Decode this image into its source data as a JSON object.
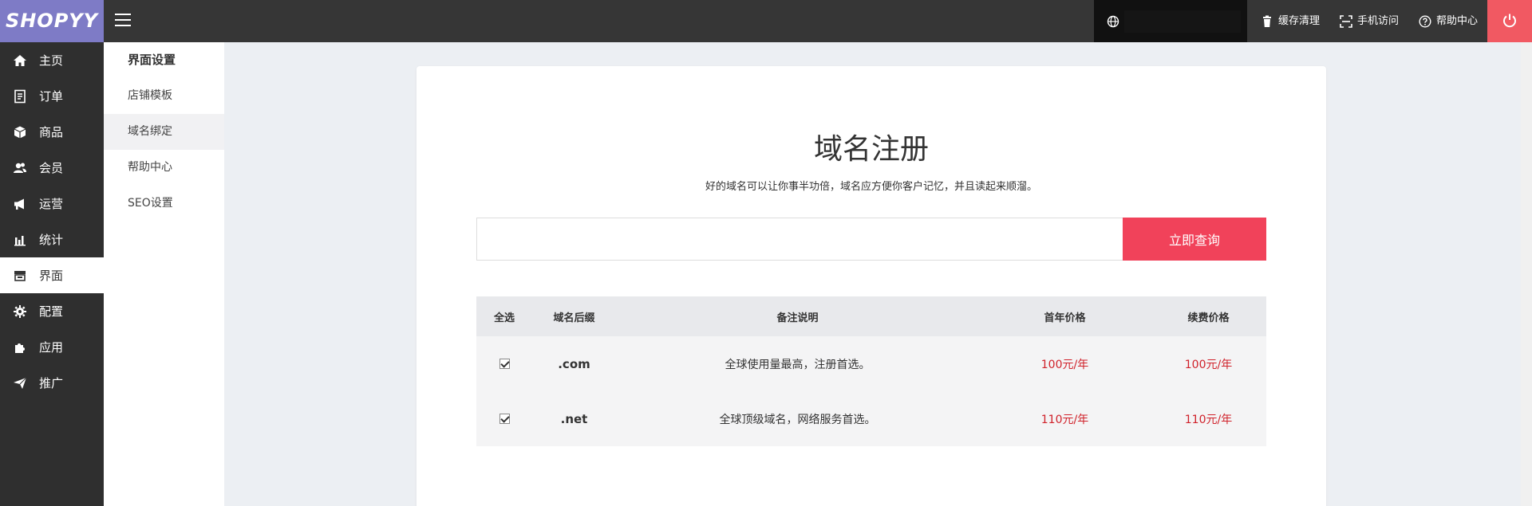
{
  "header": {
    "logo": "SHOPYY",
    "links": [
      {
        "label": "缓存清理",
        "icon": "trash-icon"
      },
      {
        "label": "手机访问",
        "icon": "mobile-scan-icon"
      },
      {
        "label": "帮助中心",
        "icon": "help-icon"
      }
    ],
    "power_icon": "power-icon"
  },
  "sidebar": {
    "items": [
      {
        "label": "主页",
        "icon": "home-icon"
      },
      {
        "label": "订单",
        "icon": "order-icon"
      },
      {
        "label": "商品",
        "icon": "box-icon"
      },
      {
        "label": "会员",
        "icon": "users-icon"
      },
      {
        "label": "运营",
        "icon": "megaphone-icon"
      },
      {
        "label": "统计",
        "icon": "bar-chart-icon"
      },
      {
        "label": "界面",
        "icon": "store-icon",
        "active": true
      },
      {
        "label": "配置",
        "icon": "gear-icon"
      },
      {
        "label": "应用",
        "icon": "puzzle-icon"
      },
      {
        "label": "推广",
        "icon": "paper-plane-icon"
      }
    ]
  },
  "subnav": {
    "title": "界面设置",
    "items": [
      {
        "label": "店铺模板"
      },
      {
        "label": "域名绑定",
        "active": true
      },
      {
        "label": "帮助中心"
      },
      {
        "label": "SEO设置"
      }
    ]
  },
  "main": {
    "title": "域名注册",
    "subtitle": "好的域名可以让你事半功倍，域名应方便你客户记忆，并且读起来顺溜。",
    "search": {
      "value": "",
      "placeholder": "",
      "button_label": "立即查询"
    },
    "table": {
      "headers": [
        "全选",
        "域名后缀",
        "备注说明",
        "首年价格",
        "续费价格"
      ],
      "rows": [
        {
          "checked": true,
          "suffix": ".com",
          "note": "全球使用量最高，注册首选。",
          "first_year": "100元/年",
          "renewal": "100元/年"
        },
        {
          "checked": true,
          "suffix": ".net",
          "note": "全球顶级域名，网络服务首选。",
          "first_year": "110元/年",
          "renewal": "110元/年"
        }
      ]
    }
  },
  "colors": {
    "logo_bg": "#7e7bc6",
    "header_bg": "#363636",
    "sidebar_bg": "#2f2f2f",
    "accent": "#f1425a",
    "power_bg": "#f15962",
    "price": "#d0212a"
  }
}
